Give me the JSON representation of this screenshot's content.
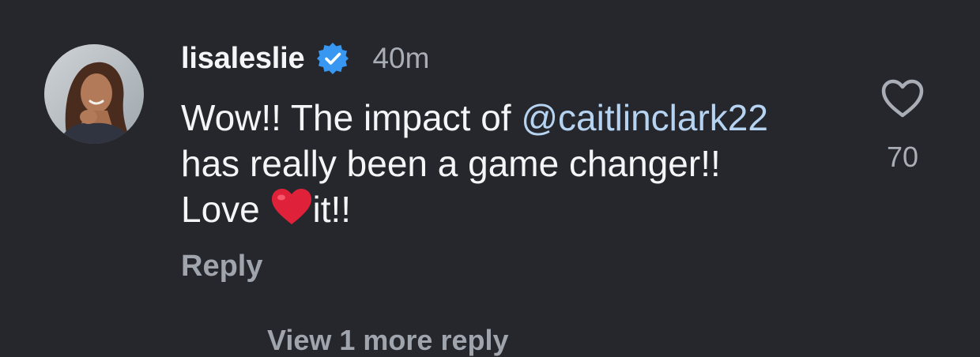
{
  "comment": {
    "avatar_icon": "profile-photo",
    "username": "lisaleslie",
    "verified_icon": "verified-badge-icon",
    "verified_color": "#3897f0",
    "timestamp": "40m",
    "text_part1": "Wow!! The impact of ",
    "mention": "@caitlinclark22",
    "text_part2": "has really been a game changer!!",
    "text_part3": "Love ",
    "emoji": "❤️",
    "text_part4": "it!!",
    "reply_label": "Reply",
    "like_icon": "heart-outline-icon",
    "like_count": "70",
    "view_more_label": "View 1 more reply"
  }
}
